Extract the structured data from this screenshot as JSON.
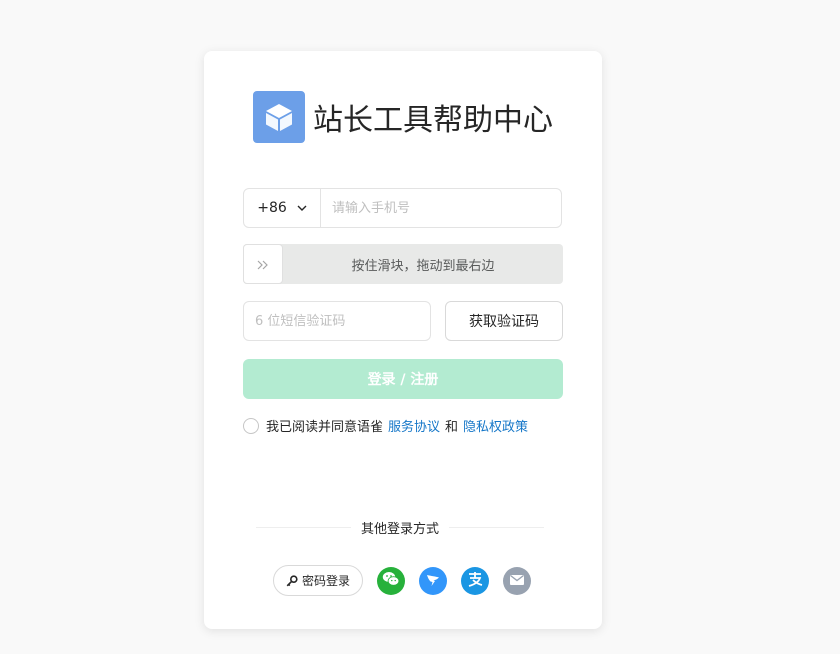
{
  "brand": {
    "title": "站长工具帮助中心",
    "logo_icon": "cube-icon",
    "logo_color": "#6c9fe8"
  },
  "phone": {
    "country_code": "+86",
    "country_icon": "chevron-down-icon",
    "placeholder": "请输入手机号",
    "value": ""
  },
  "slider": {
    "handle_icon": "double-chevron-right-icon",
    "label": "按住滑块，拖动到最右边"
  },
  "sms": {
    "placeholder": "6 位短信验证码",
    "value": "",
    "get_code_label": "获取验证码"
  },
  "login": {
    "label": "登录 / 注册",
    "color": "#b3ebd1"
  },
  "agreement": {
    "text": "我已阅读并同意语雀",
    "service_link": "服务协议",
    "and_text": "和",
    "privacy_link": "隐私权政策",
    "link_color": "#1677c8"
  },
  "other_login": {
    "title": "其他登录方式",
    "password_label": "密码登录",
    "password_icon": "key-icon",
    "methods": [
      {
        "name": "wechat",
        "icon": "wechat-icon",
        "color": "#27b13b"
      },
      {
        "name": "dingtalk",
        "icon": "dingtalk-icon",
        "color": "#3296fa"
      },
      {
        "name": "alipay",
        "icon": "alipay-icon",
        "color": "#1a96e3"
      },
      {
        "name": "email",
        "icon": "email-icon",
        "color": "#98a2b0"
      }
    ]
  }
}
